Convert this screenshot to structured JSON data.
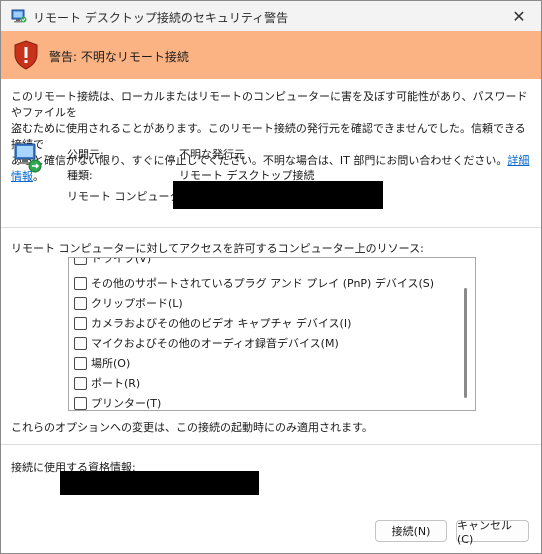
{
  "window": {
    "title": "リモート デスクトップ接続のセキュリティ警告",
    "close_symbol": "✕"
  },
  "warning": {
    "text": "警告: 不明なリモート接続"
  },
  "description": {
    "line1": "このリモート接続は、ローカルまたはリモートのコンピューターに害を及ぼす可能性があり、パスワードやファイルを",
    "line2": "盗むために使用されることがあります。このリモート接続の発行元を確認できませんでした。信頼できる接続で",
    "line3": "あると確信がない限り、すぐに停止してください。不明な場合は、IT 部門にお問い合わせください。",
    "details_link": "詳細情報",
    "line3_end": "。"
  },
  "info": {
    "publisher_label": "公開元:",
    "publisher_value": "不明な発行元",
    "type_label": "種類:",
    "type_value": "リモート デスクトップ接続",
    "remote_label": "リモート コンピューター:"
  },
  "resources": {
    "header": "リモート コンピューターに対してアクセスを許可するコンピューター上のリソース:",
    "items": [
      "ドライブ(V)",
      "その他のサポートされているプラグ アンド プレイ (PnP) デバイス(S)",
      "クリップボード(L)",
      "カメラおよびその他のビデオ キャプチャ デバイス(I)",
      "マイクおよびその他のオーディオ録音デバイス(M)",
      "場所(O)",
      "ポート(R)",
      "プリンター(T)"
    ]
  },
  "note": "これらのオプションへの変更は、この接続の起動時にのみ適用されます。",
  "credentials": {
    "label": "接続に使用する資格情報:"
  },
  "buttons": {
    "connect": "接続(N)",
    "cancel": "キャンセル(C)"
  }
}
